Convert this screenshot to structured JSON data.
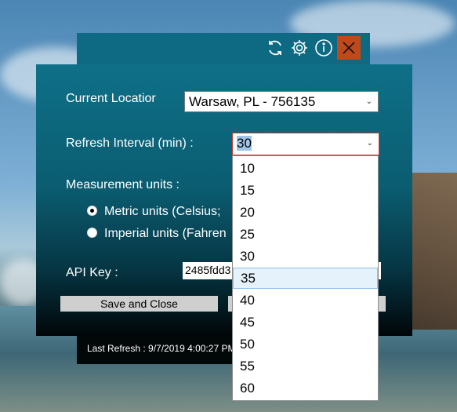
{
  "window": {
    "icons": [
      "refresh-icon",
      "gear-icon",
      "info-icon",
      "close-icon"
    ]
  },
  "form": {
    "location_label": "Current Locatior",
    "location_value": "Warsaw, PL - 756135",
    "refresh_label": "Refresh Interval (min) :",
    "refresh_value": "30",
    "units_label": "Measurement units :",
    "metric_label": "Metric units (Celsius;",
    "imperial_label": "Imperial units (Fahren",
    "api_label": "API Key :",
    "api_value": "2485fdd3",
    "save_close_label": "Save and Close",
    "second_button_label": ""
  },
  "footer": {
    "last_refresh": "Last Refresh : 9/7/2019 4:00:27 PM"
  },
  "dropdown": {
    "options": [
      "10",
      "15",
      "20",
      "25",
      "30",
      "35",
      "40",
      "45",
      "50",
      "55",
      "60"
    ],
    "highlighted": "35",
    "selected": "30"
  },
  "colors": {
    "header": "#0d6a82",
    "close_button": "#c0491b",
    "focus_border": "#c8372c",
    "selection": "#9ec5e8"
  }
}
